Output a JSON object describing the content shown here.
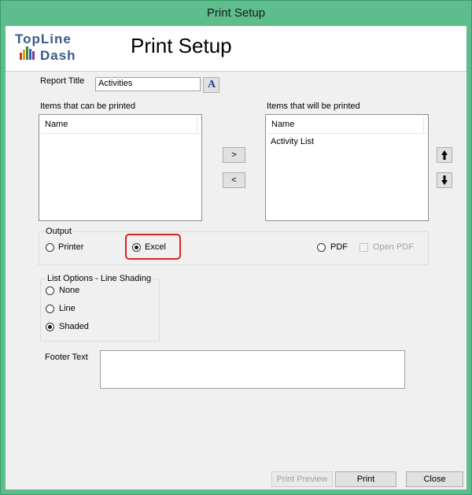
{
  "window": {
    "title": "Print Setup"
  },
  "header": {
    "logo_line1": "TopLine",
    "logo_line2": "Dash",
    "title": "Print Setup"
  },
  "report_title": {
    "label": "Report Title",
    "value": "Activities",
    "font_button": "A"
  },
  "available": {
    "label": "Items that can be printed",
    "column": "Name",
    "items": []
  },
  "selected": {
    "label": "Items that will be printed",
    "column": "Name",
    "items": [
      "Activity List"
    ]
  },
  "move_buttons": {
    "add": ">",
    "remove": "<"
  },
  "output": {
    "label": "Output",
    "printer": "Printer",
    "excel": "Excel",
    "pdf": "PDF",
    "open_pdf": "Open PDF",
    "selected": "Excel"
  },
  "list_options": {
    "label": "List Options - Line Shading",
    "none": "None",
    "line": "Line",
    "shaded": "Shaded",
    "selected": "Shaded"
  },
  "footer": {
    "label": "Footer Text",
    "value": ""
  },
  "buttons": {
    "print_preview": "Print Preview",
    "print": "Print",
    "close": "Close"
  },
  "colors": {
    "titlebar": "#5ebd8c",
    "highlight": "#e02020"
  }
}
